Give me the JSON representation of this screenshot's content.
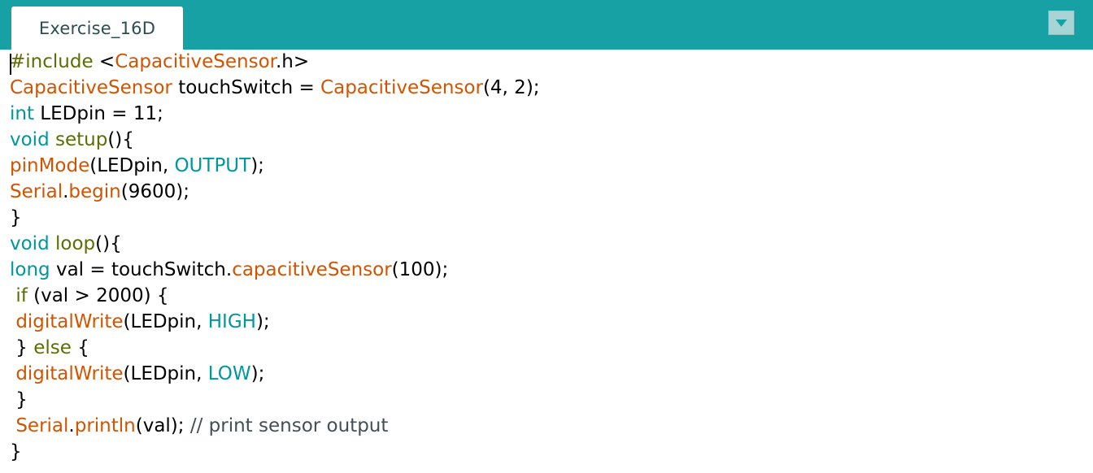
{
  "tab": {
    "label": "Exercise_16D"
  },
  "menu": {
    "icon": "triangle-down-icon"
  },
  "colors": {
    "tabbar": "#17a1a5",
    "keyword": "#00979c",
    "function": "#d35400",
    "preprocessor": "#5e6d03",
    "comment": "#434f54"
  },
  "code": {
    "lines": [
      [
        {
          "t": "#include",
          "c": "pp"
        },
        {
          "t": " <"
        },
        {
          "t": "CapacitiveSensor",
          "c": "fn"
        },
        {
          "t": ".h>"
        }
      ],
      [
        {
          "t": "CapacitiveSensor",
          "c": "fn"
        },
        {
          "t": " touchSwitch = "
        },
        {
          "t": "CapacitiveSensor",
          "c": "fn"
        },
        {
          "t": "(4, 2);"
        }
      ],
      [
        {
          "t": "int",
          "c": "kw"
        },
        {
          "t": " LEDpin = 11;"
        }
      ],
      [
        {
          "t": "void",
          "c": "kw"
        },
        {
          "t": " "
        },
        {
          "t": "setup",
          "c": "pp"
        },
        {
          "t": "(){"
        }
      ],
      [
        {
          "t": "pinMode",
          "c": "fn"
        },
        {
          "t": "(LEDpin, "
        },
        {
          "t": "OUTPUT",
          "c": "kw"
        },
        {
          "t": ");"
        }
      ],
      [
        {
          "t": "Serial",
          "c": "fn"
        },
        {
          "t": "."
        },
        {
          "t": "begin",
          "c": "fn"
        },
        {
          "t": "(9600);"
        }
      ],
      [
        {
          "t": "}"
        }
      ],
      [
        {
          "t": "void",
          "c": "kw"
        },
        {
          "t": " "
        },
        {
          "t": "loop",
          "c": "pp"
        },
        {
          "t": "(){"
        }
      ],
      [
        {
          "t": "long",
          "c": "kw"
        },
        {
          "t": " val = touchSwitch."
        },
        {
          "t": "capacitiveSensor",
          "c": "fn"
        },
        {
          "t": "(100);"
        }
      ],
      [
        {
          "t": " "
        },
        {
          "t": "if",
          "c": "pp"
        },
        {
          "t": " (val > 2000) {"
        }
      ],
      [
        {
          "t": " "
        },
        {
          "t": "digitalWrite",
          "c": "fn"
        },
        {
          "t": "(LEDpin, "
        },
        {
          "t": "HIGH",
          "c": "kw"
        },
        {
          "t": ");"
        }
      ],
      [
        {
          "t": " } "
        },
        {
          "t": "else",
          "c": "pp"
        },
        {
          "t": " {"
        }
      ],
      [
        {
          "t": " "
        },
        {
          "t": "digitalWrite",
          "c": "fn"
        },
        {
          "t": "(LEDpin, "
        },
        {
          "t": "LOW",
          "c": "kw"
        },
        {
          "t": ");"
        }
      ],
      [
        {
          "t": " }"
        }
      ],
      [
        {
          "t": " "
        },
        {
          "t": "Serial",
          "c": "fn"
        },
        {
          "t": "."
        },
        {
          "t": "println",
          "c": "fn"
        },
        {
          "t": "(val); "
        },
        {
          "t": "// print sensor output",
          "c": "ct"
        }
      ],
      [
        {
          "t": "}"
        }
      ]
    ]
  }
}
